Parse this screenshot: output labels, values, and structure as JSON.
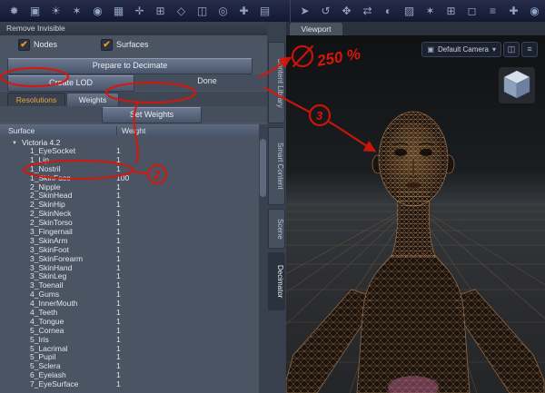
{
  "toolbar": {
    "left": [
      {
        "name": "render-icon",
        "glyph": "✹"
      },
      {
        "name": "movie-camera-icon",
        "glyph": "▣"
      },
      {
        "name": "light-icon",
        "glyph": "☀"
      },
      {
        "name": "sun-icon",
        "glyph": "✶"
      },
      {
        "name": "target-icon",
        "glyph": "◉"
      },
      {
        "name": "grid-icon",
        "glyph": "▦"
      },
      {
        "name": "node-icon",
        "glyph": "✛"
      },
      {
        "name": "cube-icon",
        "glyph": "⊞"
      },
      {
        "name": "geometry-icon",
        "glyph": "◇"
      },
      {
        "name": "surface-icon",
        "glyph": "◫"
      },
      {
        "name": "sphere-icon",
        "glyph": "◎"
      },
      {
        "name": "add-icon",
        "glyph": "✚"
      },
      {
        "name": "panel-icon",
        "glyph": "▤"
      }
    ],
    "right": [
      {
        "name": "select-cursor-icon",
        "glyph": "➤"
      },
      {
        "name": "rotate-tool-icon",
        "glyph": "↺"
      },
      {
        "name": "translate-tool-icon",
        "glyph": "✥"
      },
      {
        "name": "scale-tool-icon",
        "glyph": "⇄"
      },
      {
        "name": "orbit-tool-icon",
        "glyph": "◐"
      },
      {
        "name": "shade-icon",
        "glyph": "▨"
      },
      {
        "name": "star-icon",
        "glyph": "✶"
      },
      {
        "name": "grid-toggle-icon",
        "glyph": "⊞"
      },
      {
        "name": "frame-icon",
        "glyph": "◻"
      },
      {
        "name": "menu-icon",
        "glyph": "≡"
      },
      {
        "name": "plus-icon",
        "glyph": "✚"
      },
      {
        "name": "dot-icon",
        "glyph": "◉"
      }
    ]
  },
  "panel": {
    "title": "Remove Invisible",
    "check_glyph": "✔",
    "checkboxes": [
      {
        "label": "Nodes",
        "checked": true
      },
      {
        "label": "Surfaces",
        "checked": true
      }
    ],
    "prepare_button": "Prepare to Decimate",
    "create_lod_button": "Create LOD",
    "done_label": "Done",
    "tabs": [
      {
        "label": "Resolutions",
        "active": true
      },
      {
        "label": "Weights",
        "active": false
      }
    ],
    "set_weights_button": "Set Weights",
    "columns": [
      "Surface",
      "Weight"
    ],
    "tree_expand_glyph": "▼",
    "root_item": "Victoria 4.2",
    "surfaces": [
      {
        "name": "1_EyeSocket",
        "weight": "1"
      },
      {
        "name": "1_Lip",
        "weight": "1"
      },
      {
        "name": "1_Nostril",
        "weight": "1"
      },
      {
        "name": "1_SkinFace",
        "weight": "100"
      },
      {
        "name": "2_Nipple",
        "weight": "1"
      },
      {
        "name": "2_SkinHead",
        "weight": "1"
      },
      {
        "name": "2_SkinHip",
        "weight": "1"
      },
      {
        "name": "2_SkinNeck",
        "weight": "1"
      },
      {
        "name": "2_SkinTorso",
        "weight": "1"
      },
      {
        "name": "3_Fingernail",
        "weight": "1"
      },
      {
        "name": "3_SkinArm",
        "weight": "1"
      },
      {
        "name": "3_SkinFoot",
        "weight": "1"
      },
      {
        "name": "3_SkinForearm",
        "weight": "1"
      },
      {
        "name": "3_SkinHand",
        "weight": "1"
      },
      {
        "name": "3_SkinLeg",
        "weight": "1"
      },
      {
        "name": "3_Toenail",
        "weight": "1"
      },
      {
        "name": "4_Gums",
        "weight": "1"
      },
      {
        "name": "4_InnerMouth",
        "weight": "1"
      },
      {
        "name": "4_Teeth",
        "weight": "1"
      },
      {
        "name": "4_Tongue",
        "weight": "1"
      },
      {
        "name": "5_Cornea",
        "weight": "1"
      },
      {
        "name": "5_Iris",
        "weight": "1"
      },
      {
        "name": "5_Lacrimal",
        "weight": "1"
      },
      {
        "name": "5_Pupil",
        "weight": "1"
      },
      {
        "name": "5_Sclera",
        "weight": "1"
      },
      {
        "name": "6_Eyelash",
        "weight": "1"
      },
      {
        "name": "7_EyeSurface",
        "weight": "1"
      }
    ]
  },
  "side_tabs": [
    {
      "label": "Content Library",
      "height": 88,
      "active": false
    },
    {
      "label": "Smart Content",
      "height": 84,
      "active": false
    },
    {
      "label": "Scene",
      "height": 42,
      "active": false
    },
    {
      "label": "Decimator",
      "height": 62,
      "active": true
    }
  ],
  "viewport": {
    "tab": "Viewport",
    "camera_label": "Default Camera",
    "camera_icon_glyph": "▣",
    "dropdown_arrow_glyph": "▾",
    "iconbtn1_glyph": "◫",
    "iconbtn2_glyph": "≡"
  },
  "annotations": {
    "percent_note": "250 %",
    "step_2": "2",
    "step_3": "3",
    "red": "#dd1408"
  }
}
